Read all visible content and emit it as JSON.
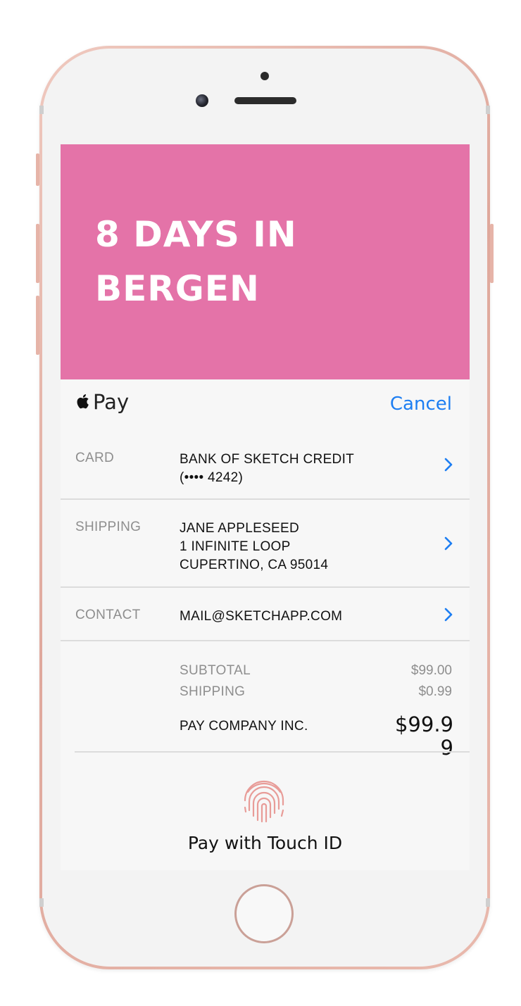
{
  "hero": {
    "title": "8 DAYS IN BERGEN"
  },
  "applepay": {
    "brand_word": "Pay",
    "cancel_label": "Cancel",
    "rows": [
      {
        "label": "CARD",
        "lines": [
          "BANK OF SKETCH CREDIT",
          "(•••• 4242)"
        ]
      },
      {
        "label": "SHIPPING",
        "lines": [
          "JANE APPLESEED",
          "1 INFINITE LOOP",
          "CUPERTINO, CA 95014"
        ]
      },
      {
        "label": "CONTACT",
        "lines": [
          "MAIL@SKETCHAPP.COM"
        ]
      }
    ],
    "summary": {
      "subtotal_label": "SUBTOTAL",
      "subtotal_value": "$99.00",
      "shipping_label": "SHIPPING",
      "shipping_value": "$0.99",
      "total_label": "PAY COMPANY INC.",
      "total_value": "$99.99"
    },
    "touch_id_label": "Pay with Touch ID"
  },
  "colors": {
    "accent": "#1d7ef2",
    "hero_bg": "#e473a8",
    "fingerprint": "#e89c98"
  },
  "icons": [
    "apple-logo-icon",
    "chevron-right-icon",
    "fingerprint-icon"
  ]
}
